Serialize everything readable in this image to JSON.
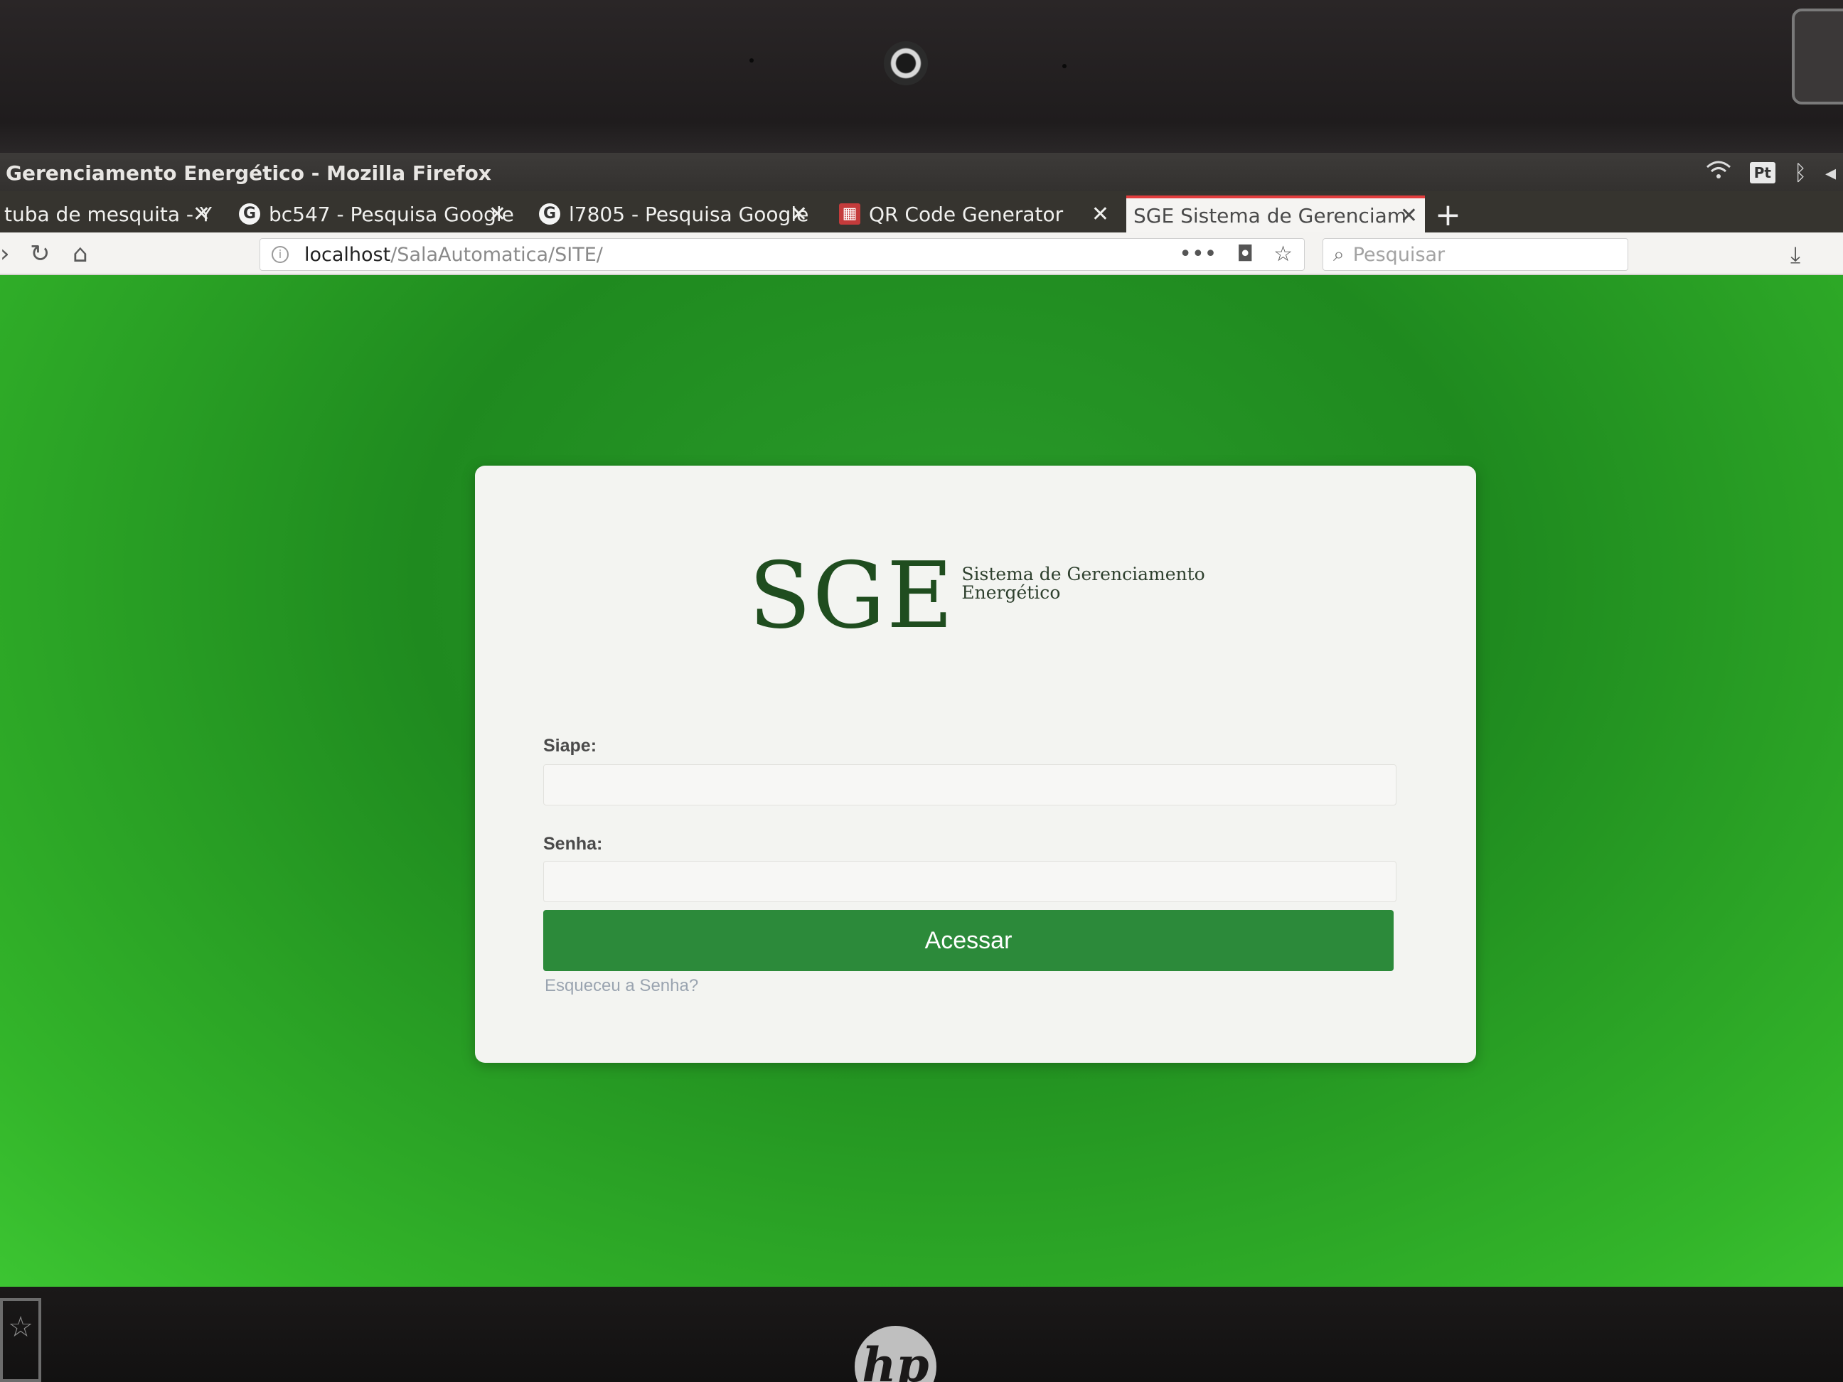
{
  "window": {
    "title": "Gerenciamento Energético - Mozilla Firefox",
    "tray": {
      "keyboard_layout": "Pt"
    }
  },
  "tabs": [
    {
      "label": "tuba de mesquita - Y",
      "favicon": "youtube-icon"
    },
    {
      "label": "bc547 - Pesquisa Google",
      "favicon": "google-icon"
    },
    {
      "label": "l7805 - Pesquisa Google",
      "favicon": "google-icon"
    },
    {
      "label": "QR Code Generator",
      "favicon": "qr-icon"
    },
    {
      "label": "SGE Sistema de Gerenciam",
      "favicon": "none",
      "active": true
    }
  ],
  "navbar": {
    "url_host": "localhost",
    "url_path": "/SalaAutomatica/SITE/",
    "search_placeholder": "Pesquisar"
  },
  "login": {
    "logo_big": "SGE",
    "logo_sub": "Sistema de Gerenciamento Energético",
    "siape_label": "Siape:",
    "siape_value": "",
    "senha_label": "Senha:",
    "senha_value": "",
    "submit_label": "Acessar",
    "forgot_link": "Esqueceu a Senha?"
  },
  "hardware": {
    "brand": "hp"
  },
  "colors": {
    "page_background": "#2a9b2a",
    "button": "#2c8a3a",
    "logo": "#1f4d1f",
    "active_tab_accent": "#e23d3d"
  }
}
